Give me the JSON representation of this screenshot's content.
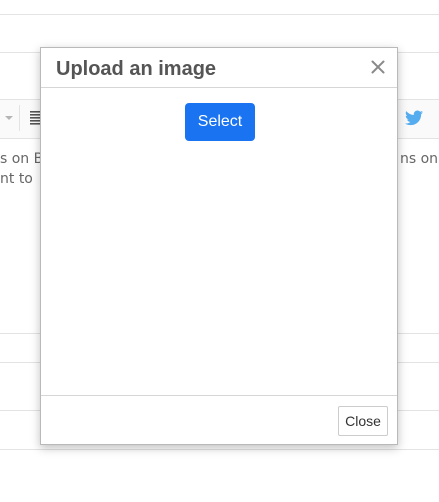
{
  "background": {
    "text_left_line1": "s on B",
    "text_left_line2": "nt to",
    "text_right_line1": "ns on"
  },
  "modal": {
    "title": "Upload an image",
    "select_label": "Select",
    "close_label": "Close",
    "close_icon": "close-icon"
  },
  "colors": {
    "primary_button": "#1a73f0",
    "twitter": "#55acee",
    "title_text": "#555555"
  }
}
